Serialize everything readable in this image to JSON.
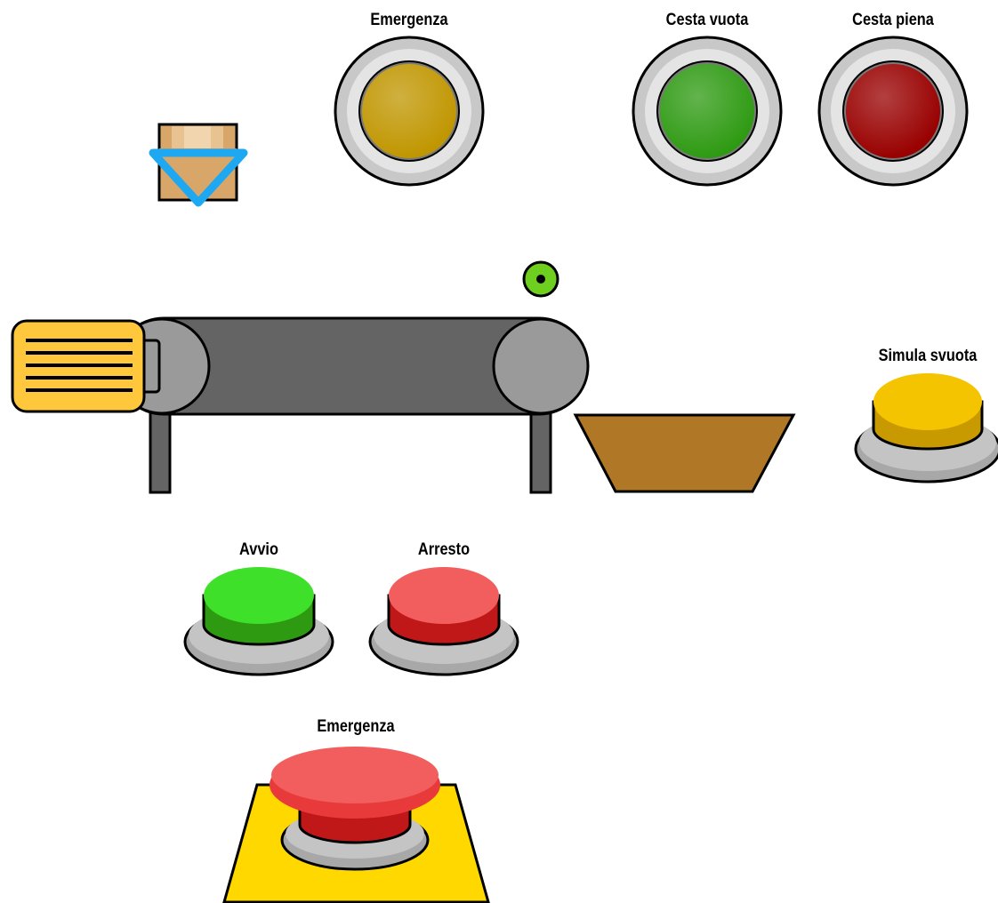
{
  "lamps": {
    "emergenza": {
      "label": "Emergenza",
      "color": "#C09600"
    },
    "cesta_vuota": {
      "label": "Cesta vuota",
      "color": "#2E9A12"
    },
    "cesta_piena": {
      "label": "Cesta piena",
      "color": "#990000"
    }
  },
  "buttons": {
    "simula_svuota": {
      "label": "Simula svuota",
      "color": "#F5C400"
    },
    "avvio": {
      "label": "Avvio",
      "color": "#3FE02A"
    },
    "arresto": {
      "label": "Arresto",
      "color": "#F25D5D"
    },
    "emergenza_stop": {
      "label": "Emergenza",
      "color": "#F25D5D"
    }
  },
  "sensor": {
    "color": "#6FCF1F"
  },
  "colors": {
    "basket": "#B07826",
    "belt": "#646464",
    "motor": "#FFC83C",
    "emergency_plate": "#FFD800",
    "drop_indicator": "#1EA8F2"
  }
}
